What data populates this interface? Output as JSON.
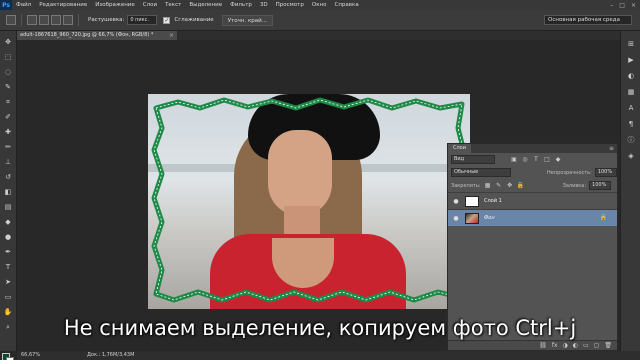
{
  "app": {
    "logo": "Ps",
    "menu": [
      "Файл",
      "Редактирование",
      "Изображение",
      "Слои",
      "Текст",
      "Выделение",
      "Фильтр",
      "3D",
      "Просмотр",
      "Окно",
      "Справка"
    ],
    "window_controls": [
      "–",
      "□",
      "×"
    ]
  },
  "options_bar": {
    "feather_label": "Растушевка:",
    "feather_value": "0 пикс.",
    "antialias_label": "Сглаживание",
    "refine_button": "Уточн. край...",
    "workspace": "Основная рабочая среда"
  },
  "document": {
    "tab_title": "adult-1867618_960_720.jpg @ 66,7% (Фон, RGB/8) *",
    "close": "×"
  },
  "tools": [
    {
      "name": "move-tool-icon",
      "glyph": "✥"
    },
    {
      "name": "marquee-tool-icon",
      "glyph": "⬚"
    },
    {
      "name": "lasso-tool-icon",
      "glyph": "◌"
    },
    {
      "name": "quick-select-tool-icon",
      "glyph": "✎"
    },
    {
      "name": "crop-tool-icon",
      "glyph": "⌗"
    },
    {
      "name": "eyedropper-tool-icon",
      "glyph": "✐"
    },
    {
      "name": "healing-brush-tool-icon",
      "glyph": "✚"
    },
    {
      "name": "brush-tool-icon",
      "glyph": "✏"
    },
    {
      "name": "clone-stamp-tool-icon",
      "glyph": "⊥"
    },
    {
      "name": "history-brush-tool-icon",
      "glyph": "↺"
    },
    {
      "name": "eraser-tool-icon",
      "glyph": "◧"
    },
    {
      "name": "gradient-tool-icon",
      "glyph": "▤"
    },
    {
      "name": "blur-tool-icon",
      "glyph": "◆"
    },
    {
      "name": "dodge-tool-icon",
      "glyph": "●"
    },
    {
      "name": "pen-tool-icon",
      "glyph": "✒"
    },
    {
      "name": "type-tool-icon",
      "glyph": "T"
    },
    {
      "name": "path-select-tool-icon",
      "glyph": "➤"
    },
    {
      "name": "shape-tool-icon",
      "glyph": "▭"
    },
    {
      "name": "hand-tool-icon",
      "glyph": "✋"
    },
    {
      "name": "zoom-tool-icon",
      "glyph": "⌕"
    }
  ],
  "colors": {
    "foreground": "#0b4d2a",
    "background": "#ffffff",
    "frame": "#1e8a48"
  },
  "right_strip": [
    {
      "name": "history-panel-icon",
      "glyph": "⊞"
    },
    {
      "name": "actions-panel-icon",
      "glyph": "▶"
    },
    {
      "name": "adjustments-panel-icon",
      "glyph": "◐"
    },
    {
      "name": "swatches-panel-icon",
      "glyph": "▦"
    },
    {
      "name": "character-panel-icon",
      "glyph": "A"
    },
    {
      "name": "paragraph-panel-icon",
      "glyph": "¶"
    },
    {
      "name": "info-panel-icon",
      "glyph": "ⓘ"
    },
    {
      "name": "layers-panel-icon",
      "glyph": "◈"
    }
  ],
  "layers_panel": {
    "title": "Слои",
    "menu": "≡",
    "filter_kind": "Вид",
    "filter_icons": [
      "▣",
      "◎",
      "T",
      "□",
      "◆"
    ],
    "blend_mode": "Обычные",
    "opacity_label": "Непрозрачность:",
    "opacity_value": "100%",
    "lock_label": "Закрепить:",
    "lock_icons": [
      "▦",
      "✎",
      "✥",
      "🔒"
    ],
    "fill_label": "Заливка:",
    "fill_value": "100%",
    "layers": [
      {
        "name": "Слой 1",
        "visible_icon": "●",
        "thumb": "white",
        "selected": false
      },
      {
        "name": "Фон",
        "visible_icon": "●",
        "thumb": "photo",
        "selected": true
      }
    ],
    "footer_icons": [
      "⛓",
      "fx",
      "◑",
      "◐",
      "▭",
      "▢",
      "🗑"
    ]
  },
  "status": {
    "zoom": "66,67%",
    "doc": "Док.: 1,76M/3,43M"
  },
  "subtitle": "Не снимаем выделение, копируем фото Ctrl+j"
}
